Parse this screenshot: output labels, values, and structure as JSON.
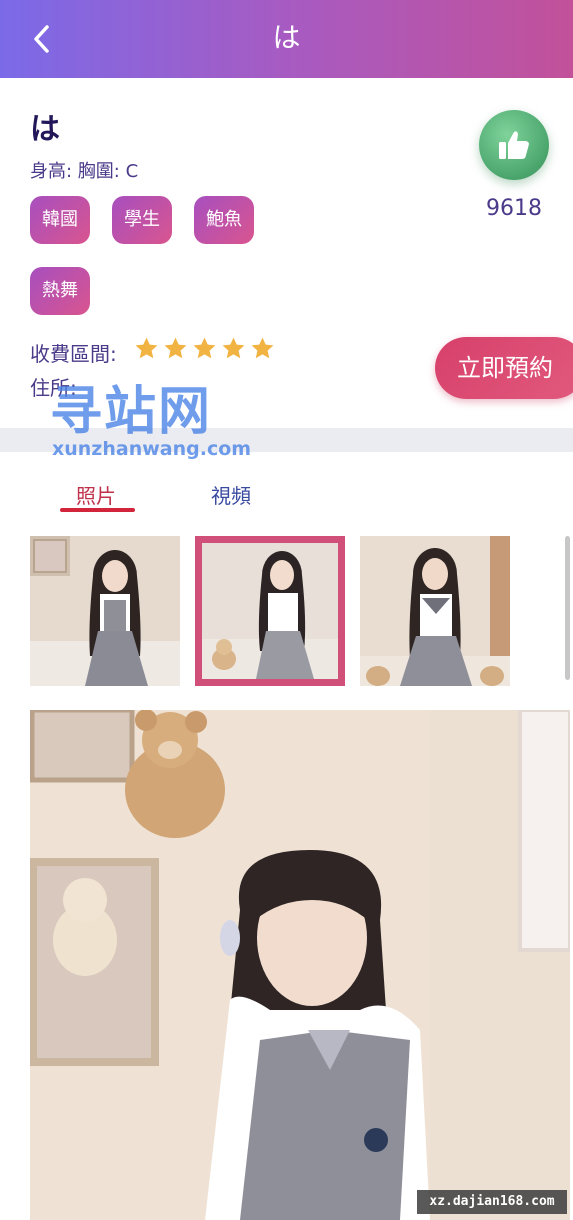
{
  "header": {
    "title": "は",
    "back_icon": "chevron-left-icon",
    "gradient": [
      "#7b6ae8",
      "#c2519a"
    ]
  },
  "profile": {
    "name": "は",
    "attributes": "身高: 胸圍: C",
    "tags": [
      "韓國",
      "學生",
      "鮑魚",
      "熱舞"
    ],
    "like_icon": "thumbs-up-icon",
    "like_count": "9618",
    "fee_label": "收費區間:",
    "fee_rating": 5,
    "fee_rating_max": 5,
    "address_label": "住所:",
    "book_button": "立即預約",
    "accent_color": "#d6406a"
  },
  "watermark": {
    "title": "寻站网",
    "site": "xunzhanwang.com",
    "image_url": "xz.dajian168.com"
  },
  "tabs": [
    {
      "label": "照片",
      "active": true
    },
    {
      "label": "視頻",
      "active": false
    }
  ],
  "gallery": {
    "selected_index": 1,
    "thumbnail_count": 3
  }
}
